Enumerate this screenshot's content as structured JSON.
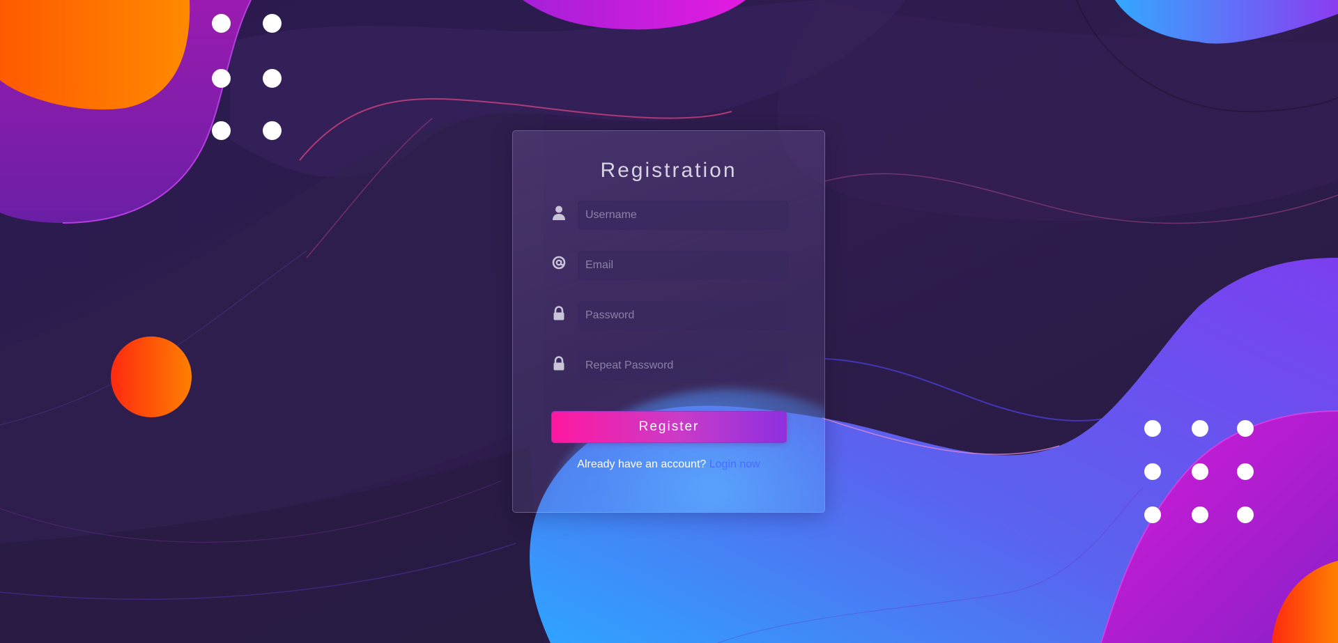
{
  "form": {
    "title": "Registration",
    "fields": [
      {
        "icon": "user-icon",
        "placeholder": "Username",
        "value": ""
      },
      {
        "icon": "at-sign-icon",
        "placeholder": "Email",
        "value": ""
      },
      {
        "icon": "lock-icon",
        "placeholder": "Password",
        "value": ""
      },
      {
        "icon": "lock-icon",
        "placeholder": "Repeat Password",
        "value": ""
      }
    ],
    "submit_label": "Register",
    "account_prompt": "Already have an account?",
    "login_link": "Login now"
  },
  "colors": {
    "background": "#2a1d44",
    "accent_pink": "#ff18a0",
    "accent_purple": "#8e2fe0",
    "link_blue": "#4a6bff",
    "orange": "#ff7a00",
    "blue": "#3aa8ff"
  }
}
